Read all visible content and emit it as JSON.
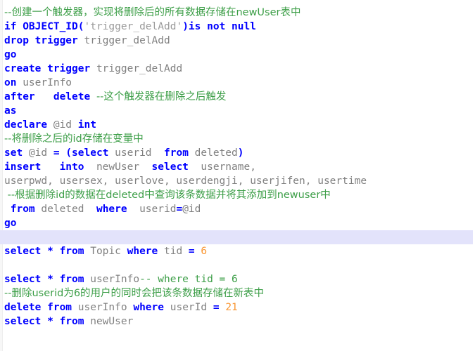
{
  "editor": {
    "title": "SQL script listing",
    "language": "SQL",
    "background_color": "#ffffff",
    "gutter_color": "#f7f7f7",
    "highlight_color": "#e3e3fb",
    "colors": {
      "keyword": "#0000ff",
      "comment": "#3c9e47",
      "identifier": "#808080",
      "number": "#fa9632",
      "string": "#9a9a9a"
    }
  },
  "lines": [
    {
      "index": 1,
      "highlighted": false,
      "text": "--创建一个触发器，实现将删除后的所有数据存储在newUser表中",
      "tokens": [
        {
          "t": "--创建一个触发器，实现将删除后的所有数据存储在newUser表中",
          "k": "cmt"
        }
      ]
    },
    {
      "index": 2,
      "highlighted": false,
      "text": "if OBJECT_ID('trigger_delAdd')is not null",
      "tokens": [
        {
          "t": "if OBJECT_ID",
          "k": "kw"
        },
        {
          "t": "(",
          "k": "kw"
        },
        {
          "t": "'trigger_delAdd'",
          "k": "str"
        },
        {
          "t": ")",
          "k": "kw"
        },
        {
          "t": "is not null",
          "k": "kw"
        }
      ]
    },
    {
      "index": 3,
      "highlighted": false,
      "text": "drop trigger trigger_delAdd",
      "tokens": [
        {
          "t": "drop trigger ",
          "k": "kw"
        },
        {
          "t": "trigger_delAdd",
          "k": "plain"
        }
      ]
    },
    {
      "index": 4,
      "highlighted": false,
      "text": "go",
      "tokens": [
        {
          "t": "go",
          "k": "kw"
        }
      ]
    },
    {
      "index": 5,
      "highlighted": false,
      "text": "create trigger trigger_delAdd",
      "tokens": [
        {
          "t": "create trigger ",
          "k": "kw"
        },
        {
          "t": "trigger_delAdd",
          "k": "plain"
        }
      ]
    },
    {
      "index": 6,
      "highlighted": false,
      "text": "on userInfo",
      "tokens": [
        {
          "t": "on ",
          "k": "kw"
        },
        {
          "t": "userInfo",
          "k": "plain"
        }
      ]
    },
    {
      "index": 7,
      "highlighted": false,
      "text": "after   delete --这个触发器在删除之后触发",
      "tokens": [
        {
          "t": "after   delete ",
          "k": "kw"
        },
        {
          "t": "--这个触发器在删除之后触发",
          "k": "cmt"
        }
      ]
    },
    {
      "index": 8,
      "highlighted": false,
      "text": "as",
      "tokens": [
        {
          "t": "as",
          "k": "kw"
        }
      ]
    },
    {
      "index": 9,
      "highlighted": false,
      "text": "declare @id int",
      "tokens": [
        {
          "t": "declare ",
          "k": "kw"
        },
        {
          "t": "@id ",
          "k": "var"
        },
        {
          "t": "int",
          "k": "kw"
        }
      ]
    },
    {
      "index": 10,
      "highlighted": false,
      "text": "--将删除之后的id存储在变量中",
      "tokens": [
        {
          "t": "--将删除之后的id存储在变量中",
          "k": "cmt"
        }
      ]
    },
    {
      "index": 11,
      "highlighted": false,
      "text": "set @id = (select userid  from deleted)",
      "tokens": [
        {
          "t": "set ",
          "k": "kw"
        },
        {
          "t": "@id ",
          "k": "var"
        },
        {
          "t": "= (select ",
          "k": "kw"
        },
        {
          "t": "userid  ",
          "k": "plain"
        },
        {
          "t": "from ",
          "k": "kw"
        },
        {
          "t": "deleted",
          "k": "plain"
        },
        {
          "t": ")",
          "k": "kw"
        }
      ]
    },
    {
      "index": 12,
      "highlighted": false,
      "text": "insert   into  newUser  select  username,",
      "tokens": [
        {
          "t": "insert   into  ",
          "k": "kw"
        },
        {
          "t": "newUser  ",
          "k": "plain"
        },
        {
          "t": "select  ",
          "k": "kw"
        },
        {
          "t": "username,",
          "k": "plain"
        }
      ]
    },
    {
      "index": 13,
      "highlighted": false,
      "text": "userpwd, usersex, userlove, userdengji, userjifen, usertime",
      "tokens": [
        {
          "t": "userpwd, usersex, userlove, userdengji, userjifen, usertime",
          "k": "plain"
        }
      ]
    },
    {
      "index": 14,
      "highlighted": false,
      "text": " --根据删除id的数据在deleted中查询该条数据并将其添加到newuser中",
      "tokens": [
        {
          "t": " --根据删除id的数据在deleted中查询该条数据并将其添加到newuser中",
          "k": "cmt"
        }
      ]
    },
    {
      "index": 15,
      "highlighted": false,
      "text": " from deleted  where  userid=@id",
      "tokens": [
        {
          "t": " from ",
          "k": "kw"
        },
        {
          "t": "deleted  ",
          "k": "plain"
        },
        {
          "t": "where  ",
          "k": "kw"
        },
        {
          "t": "userid",
          "k": "plain"
        },
        {
          "t": "=",
          "k": "kw"
        },
        {
          "t": "@id",
          "k": "var"
        }
      ]
    },
    {
      "index": 16,
      "highlighted": false,
      "text": "go",
      "tokens": [
        {
          "t": "go",
          "k": "kw"
        }
      ]
    },
    {
      "index": 17,
      "highlighted": true,
      "text": "",
      "tokens": []
    },
    {
      "index": 18,
      "highlighted": false,
      "text": "select * from Topic where tid = 6",
      "tokens": [
        {
          "t": "select * from ",
          "k": "kw"
        },
        {
          "t": "Topic ",
          "k": "plain"
        },
        {
          "t": "where ",
          "k": "kw"
        },
        {
          "t": "tid ",
          "k": "plain"
        },
        {
          "t": "= ",
          "k": "kw"
        },
        {
          "t": "6",
          "k": "num"
        }
      ]
    },
    {
      "index": 19,
      "highlighted": false,
      "text": "",
      "tokens": []
    },
    {
      "index": 20,
      "highlighted": false,
      "text": "select * from userInfo-- where tid = 6",
      "tokens": [
        {
          "t": "select * from ",
          "k": "kw"
        },
        {
          "t": "userInfo",
          "k": "plain"
        },
        {
          "t": "-- where tid = 6",
          "k": "cmt"
        }
      ]
    },
    {
      "index": 21,
      "highlighted": false,
      "text": "--删除userid为6的用户的同时会把该条数据存储在新表中",
      "tokens": [
        {
          "t": "--删除userid为6的用户的同时会把该条数据存储在新表中",
          "k": "cmt"
        }
      ]
    },
    {
      "index": 22,
      "highlighted": false,
      "text": "delete from userInfo where userId = 21",
      "tokens": [
        {
          "t": "delete from ",
          "k": "kw"
        },
        {
          "t": "userInfo ",
          "k": "plain"
        },
        {
          "t": "where ",
          "k": "kw"
        },
        {
          "t": "userId ",
          "k": "plain"
        },
        {
          "t": "= ",
          "k": "kw"
        },
        {
          "t": "21",
          "k": "num"
        }
      ]
    },
    {
      "index": 23,
      "highlighted": false,
      "text": "select * from newUser",
      "tokens": [
        {
          "t": "select * from ",
          "k": "kw"
        },
        {
          "t": "newUser",
          "k": "plain"
        }
      ]
    }
  ]
}
